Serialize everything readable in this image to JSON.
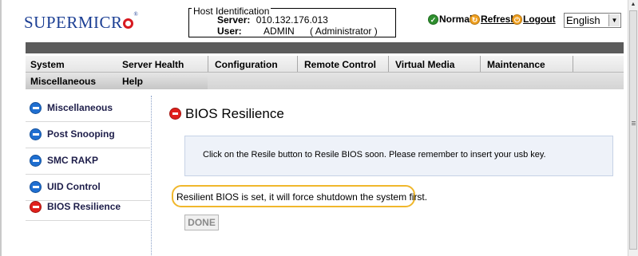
{
  "header": {
    "logo_text": "SUPERMICR",
    "logo_reg": "®",
    "host": {
      "legend": "Host Identification",
      "server_label": "Server:",
      "server_value": "010.132.176.013",
      "user_label": "User:",
      "user_value": "ADMIN",
      "user_role": "( Administrator )"
    },
    "status_label": "Normal",
    "refresh_label": "Refresh",
    "logout_label": "Logout",
    "language_value": "English"
  },
  "menu": {
    "row1": [
      "System",
      "Server Health",
      "Configuration",
      "Remote Control",
      "Virtual Media",
      "Maintenance"
    ],
    "row2": [
      "Miscellaneous",
      "Help"
    ]
  },
  "sidebar": {
    "items": [
      {
        "label": "Miscellaneous"
      },
      {
        "label": "Post Snooping"
      },
      {
        "label": "SMC RAKP"
      },
      {
        "label": "UID Control"
      },
      {
        "label": "BIOS Resilience"
      }
    ]
  },
  "main": {
    "title": "BIOS Resilience",
    "info_text": "Click on the Resile button to Resile BIOS soon. Please remember to insert your usb key.",
    "notice_text": "Resilient BIOS is set, it will force shutdown the system first.",
    "done_label": "DONE"
  },
  "colors": {
    "accent_blue": "#1f6fd1",
    "accent_red": "#e0201b",
    "highlight_border": "#f0b72c",
    "info_background": "#eef2f9"
  }
}
